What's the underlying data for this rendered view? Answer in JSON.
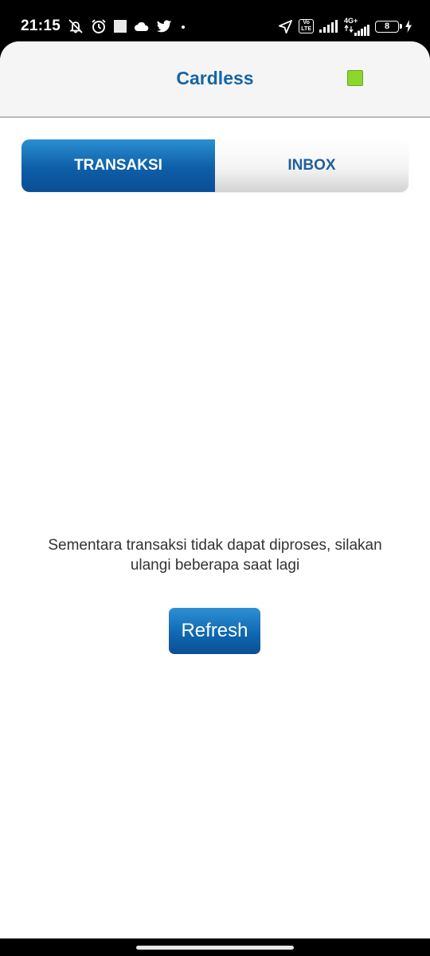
{
  "status_bar": {
    "time": "21:15",
    "battery_level": "8",
    "network_type": "4G+",
    "volte_label_top": "Vo",
    "volte_label_bottom": "LTE",
    "icons_left": [
      "mute-vibrate-icon",
      "alarm-icon",
      "square-notification-icon",
      "cloud-icon",
      "twitter-icon",
      "dot-icon"
    ],
    "icons_right": [
      "location-arrow-icon",
      "volte-icon",
      "signal-icon",
      "signal-4g-icon",
      "battery-icon",
      "charging-icon"
    ]
  },
  "header": {
    "title": "Cardless",
    "indicator_color": "#8cd62d"
  },
  "tabs": [
    {
      "label": "TRANSAKSI",
      "active": true
    },
    {
      "label": "INBOX",
      "active": false
    }
  ],
  "main": {
    "message": "Sementara transaksi tidak dapat diproses, silakan ulangi beberapa saat lagi",
    "refresh_label": "Refresh"
  },
  "colors": {
    "accent": "#1566a6",
    "button_gradient_top": "#2d90d3",
    "button_gradient_bottom": "#0a4f93"
  }
}
